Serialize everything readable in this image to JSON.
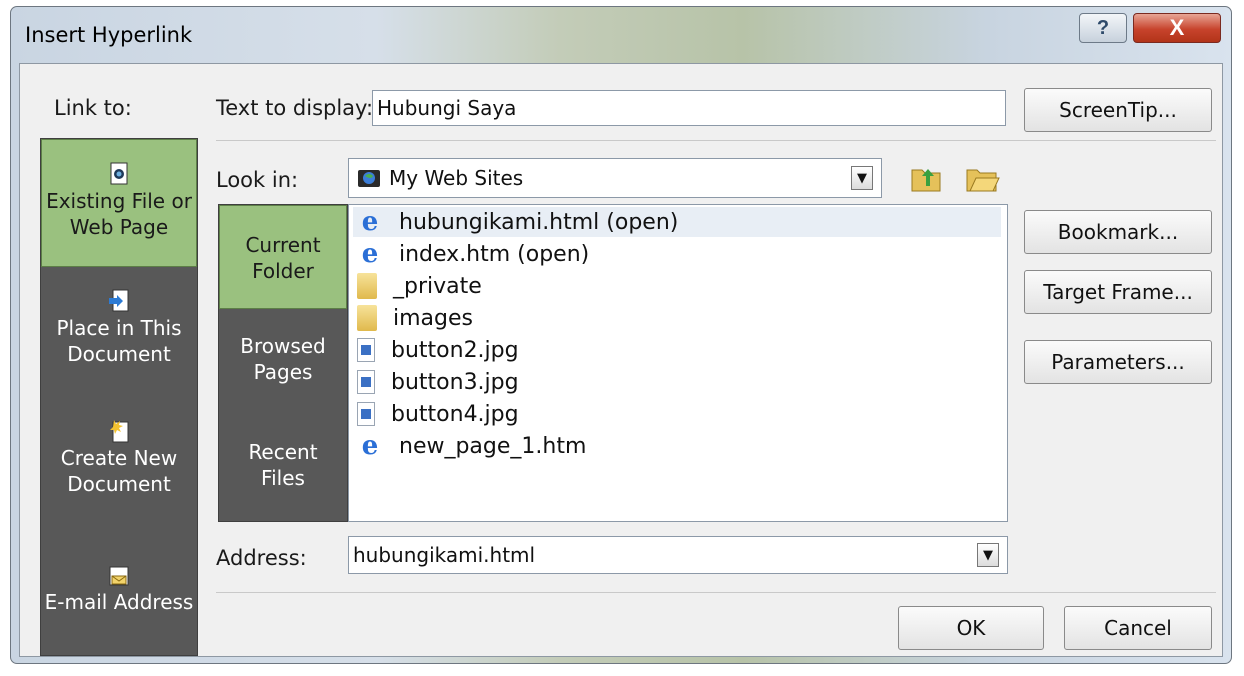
{
  "window": {
    "title": "Insert Hyperlink",
    "help_label": "?",
    "close_label": "X"
  },
  "link_to": {
    "label": "Link to:",
    "items": [
      {
        "line1": "Existing File or",
        "line2": "Web Page",
        "icon": "existing-file-icon",
        "active": true
      },
      {
        "line1": "Place in This",
        "line2": "Document",
        "icon": "place-in-document-icon",
        "active": false
      },
      {
        "line1": "Create New",
        "line2": "Document",
        "icon": "create-new-document-icon",
        "active": false
      },
      {
        "line1": "E-mail Address",
        "line2": "",
        "icon": "email-address-icon",
        "active": false
      }
    ]
  },
  "text_to_display": {
    "label": "Text to display:",
    "value": "Hubungi Saya"
  },
  "look_in": {
    "label": "Look in:",
    "value": "My Web Sites"
  },
  "modes": [
    {
      "line1": "Current",
      "line2": "Folder",
      "active": true
    },
    {
      "line1": "Browsed",
      "line2": "Pages",
      "active": false
    },
    {
      "line1": "Recent",
      "line2": "Files",
      "active": false
    }
  ],
  "files": [
    {
      "name": "hubungikami.html (open)",
      "type": "ie",
      "selected": true
    },
    {
      "name": "index.htm (open)",
      "type": "ie",
      "selected": false
    },
    {
      "name": "_private",
      "type": "folder",
      "selected": false
    },
    {
      "name": "images",
      "type": "folder",
      "selected": false
    },
    {
      "name": "button2.jpg",
      "type": "jpg",
      "selected": false
    },
    {
      "name": "button3.jpg",
      "type": "jpg",
      "selected": false
    },
    {
      "name": "button4.jpg",
      "type": "jpg",
      "selected": false
    },
    {
      "name": "new_page_1.htm",
      "type": "ie",
      "selected": false
    }
  ],
  "address": {
    "label": "Address:",
    "value": "hubungikami.html"
  },
  "buttons": {
    "screentip": "ScreenTip...",
    "bookmark": "Bookmark...",
    "target_frame": "Target Frame...",
    "parameters": "Parameters...",
    "ok": "OK",
    "cancel": "Cancel"
  },
  "colors": {
    "active_green": "#9ac17f",
    "nav_gray": "#585858"
  }
}
